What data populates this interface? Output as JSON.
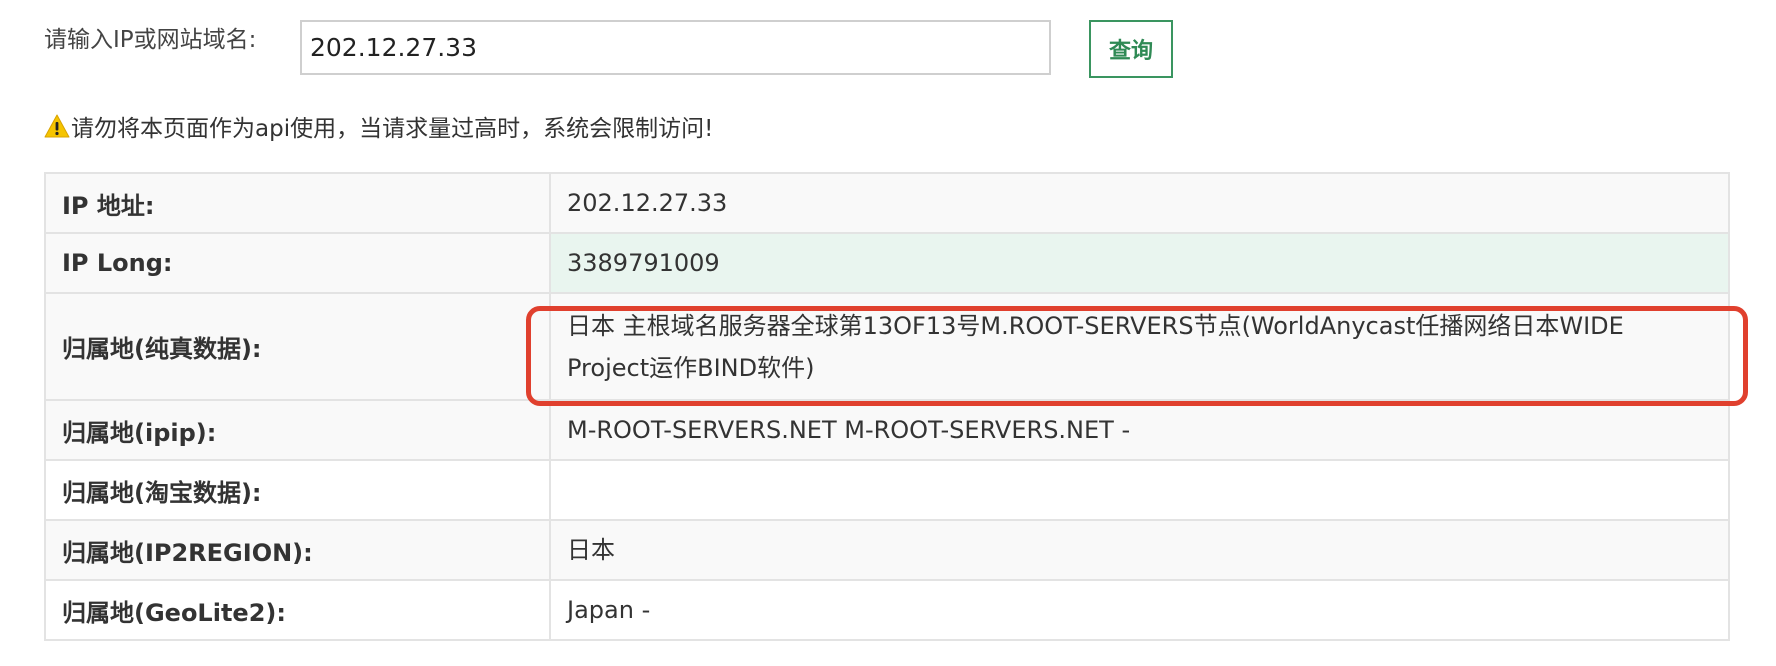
{
  "search": {
    "label": "请输入IP或网站域名:",
    "value": "202.12.27.33",
    "button_label": "查询"
  },
  "warning": {
    "icon": "warning-icon",
    "text": "请勿将本页面作为api使用，当请求量过高时，系统会限制访问!"
  },
  "rows": [
    {
      "key": "IP 地址:",
      "value": "202.12.27.33"
    },
    {
      "key": "IP Long:",
      "value": "3389791009"
    },
    {
      "key": "归属地(纯真数据):",
      "value": "日本 主根域名服务器全球第13OF13号M.ROOT-SERVERS节点(WorldAnycast任播网络日本WIDE Project运作BIND软件)"
    },
    {
      "key": "归属地(ipip):",
      "value": "M-ROOT-SERVERS.NET M-ROOT-SERVERS.NET -"
    },
    {
      "key": "归属地(淘宝数据):",
      "value": ""
    },
    {
      "key": "归属地(IP2REGION):",
      "value": "日本"
    },
    {
      "key": "归属地(GeoLite2):",
      "value": "Japan -"
    }
  ],
  "colors": {
    "button_accent": "#3a9560",
    "highlight_annotation": "#e0402e",
    "row_hover_bg": "#e9f5ef"
  }
}
